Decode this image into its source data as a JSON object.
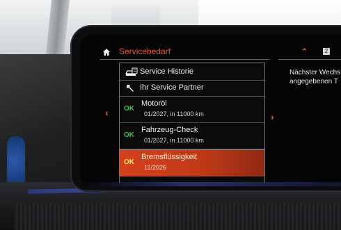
{
  "header": {
    "title": "Servicebedarf",
    "page_indicator": "2",
    "home_icon": "home-icon",
    "up_icon": "chevron-up-icon",
    "accent_color": "#e85a2a"
  },
  "menu": {
    "items": [
      {
        "label": "Service Historie",
        "icon": "car-history-icon"
      },
      {
        "label": "Ihr Service Partner",
        "icon": "wrench-icon"
      }
    ]
  },
  "service_items": [
    {
      "status": "OK",
      "name": "Motoröl",
      "detail": "01/2027, in 11000 km",
      "status_color": "#36c24a"
    },
    {
      "status": "OK",
      "name": "Fahrzeug-Check",
      "detail": "01/2027, in 11000 km",
      "status_color": "#36c24a"
    },
    {
      "status": "OK",
      "name": "Bremsflüssigkeit",
      "detail": "11/2026",
      "selected": true,
      "highlight_color": "#d4401c"
    }
  ],
  "navigation": {
    "left_icon": "chevron-left-icon",
    "right_icon": "chevron-right-icon"
  },
  "right_panel": {
    "line1": "Nächster Wechs",
    "line2": "angegebenen T"
  }
}
